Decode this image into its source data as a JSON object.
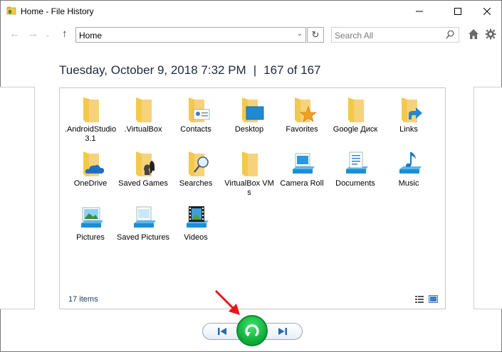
{
  "window": {
    "title": "Home - File History",
    "minimize_icon": "minimize-icon",
    "maximize_icon": "maximize-icon",
    "close_icon": "close-icon"
  },
  "navbar": {
    "back_icon": "arrow-left-icon",
    "forward_icon": "arrow-right-icon",
    "up_icon": "arrow-up-icon",
    "address": "Home",
    "search_placeholder": "Search All"
  },
  "header": {
    "date": "Tuesday, October 9, 2018 7:32 PM",
    "separator": "|",
    "position": "167 of 167"
  },
  "items": [
    {
      "label": ".AndroidStudio3.1",
      "icon": "folder-icon"
    },
    {
      "label": ".VirtualBox",
      "icon": "folder-icon"
    },
    {
      "label": "Contacts",
      "icon": "contacts-folder-icon"
    },
    {
      "label": "Desktop",
      "icon": "desktop-folder-icon"
    },
    {
      "label": "Favorites",
      "icon": "favorites-folder-icon"
    },
    {
      "label": "Google Диск",
      "icon": "folder-icon"
    },
    {
      "label": "Links",
      "icon": "links-folder-icon"
    },
    {
      "label": "OneDrive",
      "icon": "onedrive-folder-icon"
    },
    {
      "label": "Saved Games",
      "icon": "saved-games-folder-icon"
    },
    {
      "label": "Searches",
      "icon": "searches-folder-icon"
    },
    {
      "label": "VirtualBox VMs",
      "icon": "folder-icon"
    },
    {
      "label": "Camera Roll",
      "icon": "camera-roll-library-icon"
    },
    {
      "label": "Documents",
      "icon": "documents-library-icon"
    },
    {
      "label": "Music",
      "icon": "music-library-icon"
    },
    {
      "label": "Pictures",
      "icon": "pictures-library-icon"
    },
    {
      "label": "Saved Pictures",
      "icon": "saved-pictures-library-icon"
    },
    {
      "label": "Videos",
      "icon": "videos-library-icon"
    }
  ],
  "status": {
    "count": "17 items"
  },
  "colors": {
    "folder": "#f2c94c",
    "folder_dark": "#e0a82e",
    "accent_blue": "#1f8ad1",
    "restore_green": "#19c24a"
  }
}
